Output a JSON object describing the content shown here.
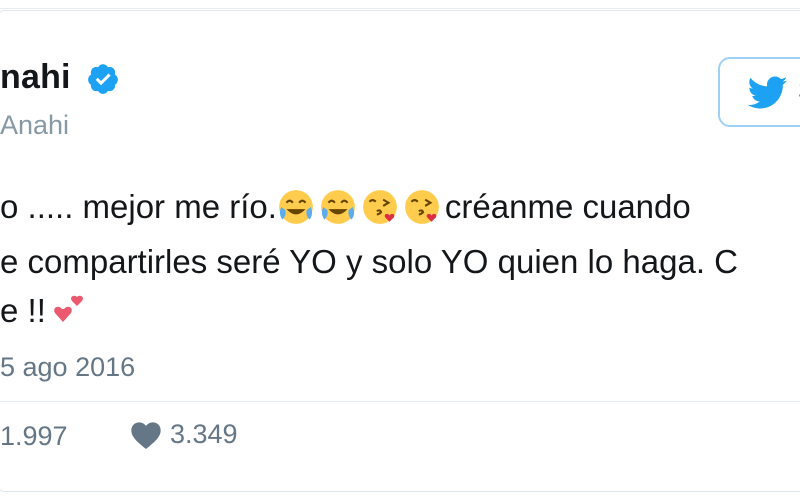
{
  "tweet": {
    "author_name": "nahi",
    "handle": "Anahi",
    "follow_button_partial": "S",
    "text_line1": "o ..... mejor me río.",
    "text_line1_after": "créanme cuando",
    "text_line2": "e compartirles seré YO y solo YO quien lo haga. C",
    "text_line3": "e !!",
    "date": "5 ago 2016",
    "retweets": "1.997",
    "likes": "3.349"
  },
  "icons": {
    "verified": "verified-badge-icon",
    "twitter_bird": "twitter-bird-icon",
    "heart": "heart-icon",
    "emoji_laugh": "face-with-tears-of-joy-icon",
    "emoji_kiss": "face-blowing-kiss-icon",
    "emoji_hearts": "two-hearts-icon"
  },
  "colors": {
    "twitter_blue": "#1da1f2",
    "meta_gray": "#657786",
    "handle_gray": "#8899a6",
    "heart_pink": "#e0245e"
  }
}
